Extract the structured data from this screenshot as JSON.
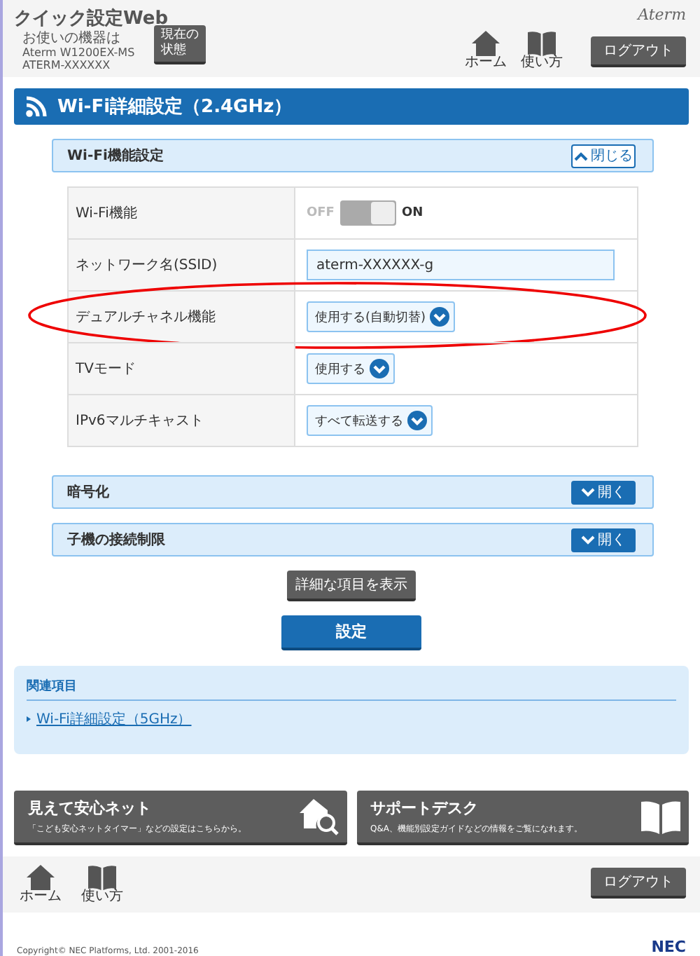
{
  "header": {
    "title": "クイック設定Web",
    "device_lines": [
      "お使いの機器は",
      "Aterm W1200EX-MS",
      "ATERM-XXXXXX"
    ],
    "status_button": [
      "現在の",
      "状態"
    ],
    "brand": "Aterm",
    "nav": [
      {
        "kind": "home",
        "label": "ホーム"
      },
      {
        "kind": "book",
        "label": "使い方"
      }
    ],
    "logout": "ログアウト"
  },
  "page_title": "Wi-Fi詳細設定（2.4GHz）",
  "sections": [
    {
      "title": "Wi-Fi機能設定",
      "toggle": "閉じる",
      "expanded": true,
      "rows": [
        {
          "kind": "switch",
          "label": "Wi-Fi機能",
          "off_label": "OFF",
          "on_label": "ON",
          "on": true,
          "highlighted": false
        },
        {
          "kind": "text",
          "label": "ネットワーク名(SSID)",
          "value": "aterm-XXXXXX-g",
          "highlighted": false
        },
        {
          "kind": "select",
          "label": "デュアルチャネル機能",
          "value": "使用する(自動切替)",
          "highlighted": true
        },
        {
          "kind": "select",
          "label": "TVモード",
          "value": "使用する",
          "highlighted": false
        },
        {
          "kind": "select",
          "label": "IPv6マルチキャスト",
          "value": "すべて転送する",
          "highlighted": false
        }
      ]
    },
    {
      "title": "暗号化",
      "toggle": "開く",
      "expanded": false
    },
    {
      "title": "子機の接続制限",
      "toggle": "開く",
      "expanded": false
    }
  ],
  "detail_button": "詳細な項目を表示",
  "submit_button": "設定",
  "related": {
    "title": "関連項目",
    "links": [
      "Wi-Fi詳細設定（5GHz）"
    ]
  },
  "cards": [
    {
      "kind": "search-home",
      "title": "見えて安心ネット",
      "description": "「こども安心ネットタイマー」などの設定はこちらから。"
    },
    {
      "kind": "book",
      "title": "サポートデスク",
      "description": "Q&A、機能別設定ガイドなどの情報をご覧になれます。"
    }
  ],
  "footer": {
    "nav": [
      {
        "kind": "home",
        "label": "ホーム"
      },
      {
        "kind": "book",
        "label": "使い方"
      }
    ],
    "logout": "ログアウト",
    "copyright": "Copyright© NEC Platforms, Ltd. 2001-2016",
    "logo": "NEC"
  }
}
